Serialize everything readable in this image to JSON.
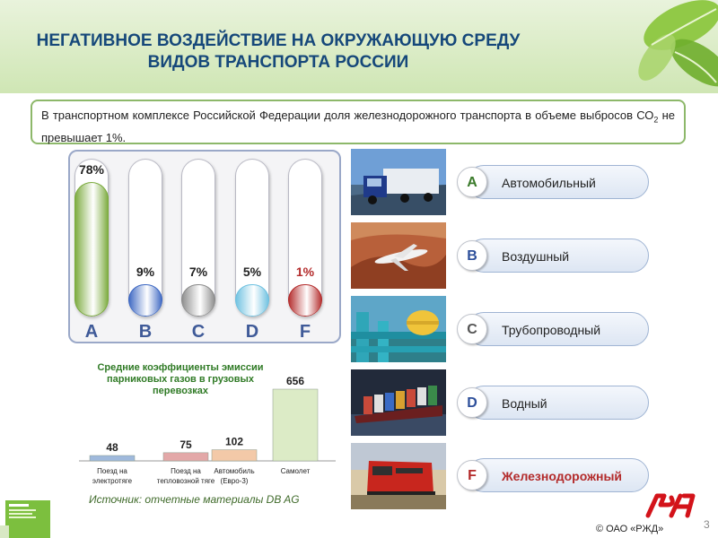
{
  "header": {
    "title_line1": "НЕГАТИВНОЕ ВОЗДЕЙСТВИЕ НА ОКРУЖАЮЩУЮ СРЕДУ",
    "title_line2": "ВИДОВ ТРАНСПОРТА РОССИИ"
  },
  "info": {
    "text_before": "В транспортном комплексе Российской Федерации доля железнодорожного транспорта в объеме выбросов СО",
    "subscript": "2",
    "text_after": "  не превышает 1%."
  },
  "tubes": [
    {
      "letter": "A",
      "label": "78%",
      "value": 78,
      "color": "#7aaa3c"
    },
    {
      "letter": "B",
      "label": "9%",
      "value": 9,
      "color": "#3b66c2"
    },
    {
      "letter": "C",
      "label": "7%",
      "value": 7,
      "color": "#8a8a8a"
    },
    {
      "letter": "D",
      "label": "5%",
      "value": 5,
      "color": "#6cc0e0"
    },
    {
      "letter": "F",
      "label": "1%",
      "value": 1,
      "color": "#b32a2a"
    }
  ],
  "chart_data": {
    "type": "bar",
    "title": "Средние коэффициенты эмиссии парниковых газов в грузовых перевозках",
    "categories": [
      "Поезд на электротяге",
      "Поезд на тепловозной тяге",
      "Автомобиль (Евро-3)",
      "Самолет"
    ],
    "category_lines": [
      [
        "Поезд на",
        "электротяге"
      ],
      [
        "Поезд на",
        "тепловозной тяге"
      ],
      [
        "Автомобиль",
        "(Евро-3)"
      ],
      [
        "Самолет"
      ]
    ],
    "values": [
      48,
      75,
      102,
      656
    ],
    "colors": [
      "#9fb9dc",
      "#e3a8a8",
      "#f3c9a8",
      "#dcebc6"
    ]
  },
  "source": "Источник: отчетные материалы DB AG",
  "legend": [
    {
      "letter": "A",
      "label": "Автомобильный",
      "letter_color": "#3a7a2a",
      "label_color": "#222222"
    },
    {
      "letter": "B",
      "label": "Воздушный",
      "letter_color": "#2d4f9a",
      "label_color": "#222222"
    },
    {
      "letter": "C",
      "label": "Трубопроводный",
      "letter_color": "#555555",
      "label_color": "#222222"
    },
    {
      "letter": "D",
      "label": "Водный",
      "letter_color": "#2d4f9a",
      "label_color": "#222222"
    },
    {
      "letter": "F",
      "label": "Железнодорожный",
      "letter_color": "#b32a2a",
      "label_color": "#b32a2a"
    }
  ],
  "footer": {
    "copyright": "© ОАО «РЖД»",
    "page_number": "3"
  }
}
